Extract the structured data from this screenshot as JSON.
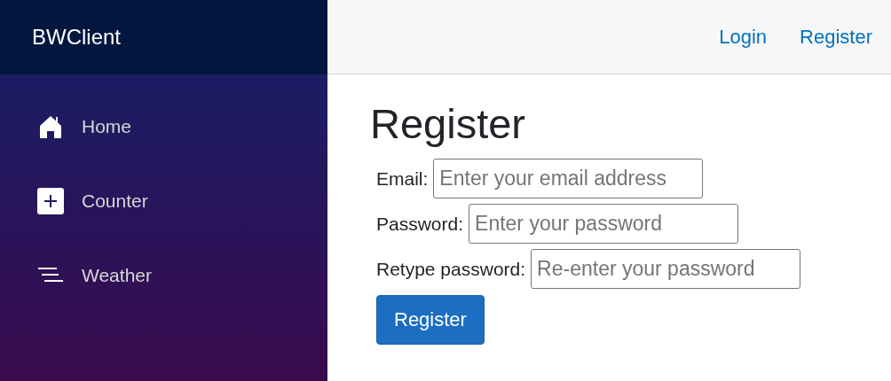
{
  "sidebar": {
    "brand": "BWClient",
    "items": [
      {
        "label": "Home",
        "kind": "home"
      },
      {
        "label": "Counter",
        "kind": "plus"
      },
      {
        "label": "Weather",
        "kind": "list"
      }
    ]
  },
  "top_bar": {
    "links": [
      "Login",
      "Register"
    ]
  },
  "page": {
    "heading": "Register",
    "fields": [
      {
        "label": "Email:",
        "placeholder": "Enter your email address"
      },
      {
        "label": "Password:",
        "placeholder": "Enter your password"
      },
      {
        "label": "Retype password:",
        "placeholder": "Re-enter your password"
      }
    ],
    "submit": "Register"
  }
}
